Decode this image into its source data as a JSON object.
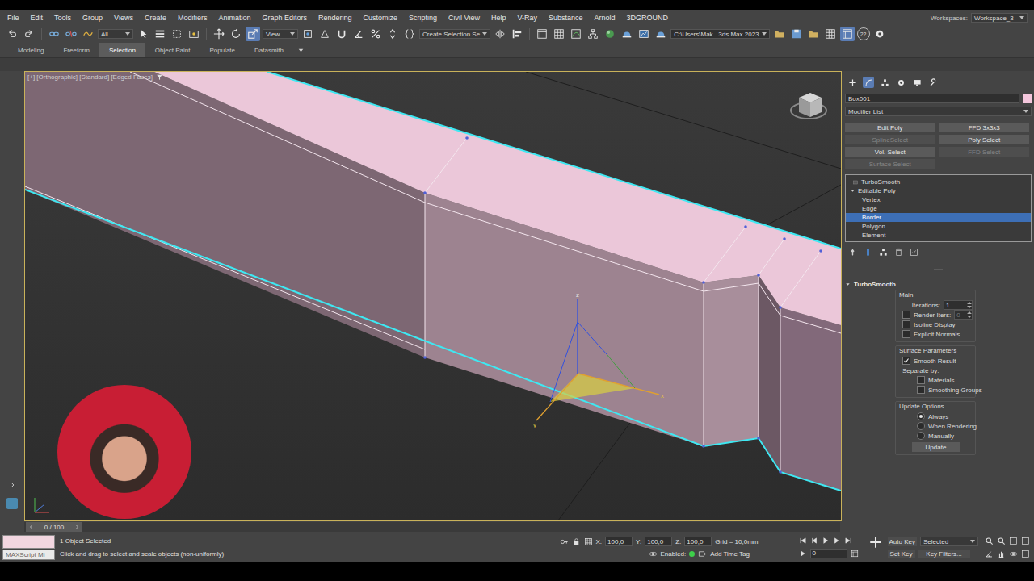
{
  "menu": [
    "File",
    "Edit",
    "Tools",
    "Group",
    "Views",
    "Create",
    "Modifiers",
    "Animation",
    "Graph Editors",
    "Rendering",
    "Customize",
    "Scripting",
    "Civil View",
    "Help",
    "V-Ray",
    "Substance",
    "Arnold",
    "3DGROUND"
  ],
  "workspace": {
    "label": "Workspaces:",
    "value": "Workspace_3"
  },
  "toolbar": {
    "selectionFilter": "All",
    "referenceCoordinates": "View",
    "namedSelection": "Create Selection Se",
    "projectPath": "C:\\Users\\Mak...3ds Max 2023",
    "badge": "22"
  },
  "ribbon": [
    {
      "label": "Modeling",
      "selected": false
    },
    {
      "label": "Freeform",
      "selected": false
    },
    {
      "label": "Selection",
      "selected": true
    },
    {
      "label": "Object Paint",
      "selected": false
    },
    {
      "label": "Populate",
      "selected": false
    },
    {
      "label": "Datasmith",
      "selected": false
    }
  ],
  "viewport": {
    "label": "[+] [Orthographic] [Standard] [Edged Faces]",
    "gizmoAxes": [
      "z",
      "x",
      "y"
    ]
  },
  "commandPanel": {
    "objectName": "Box001",
    "objectColor": "#f4c6dc",
    "modifierList": "Modifier List",
    "modifierButtons": [
      {
        "label": "Edit Poly",
        "disabled": false
      },
      {
        "label": "FFD 3x3x3",
        "disabled": false
      },
      {
        "label": "SplineSelect",
        "disabled": true
      },
      {
        "label": "Poly Select",
        "disabled": false
      },
      {
        "label": "Vol. Select",
        "disabled": false
      },
      {
        "label": "FFD Select",
        "disabled": true
      },
      {
        "label": "Surface Select",
        "disabled": true
      }
    ],
    "stack": [
      {
        "label": "TurboSmooth",
        "kind": "modifier",
        "selected": false
      },
      {
        "label": "Editable Poly",
        "kind": "object",
        "selected": false,
        "expanded": true
      },
      {
        "label": "Vertex",
        "kind": "subobject",
        "selected": false
      },
      {
        "label": "Edge",
        "kind": "subobject",
        "selected": false
      },
      {
        "label": "Border",
        "kind": "subobject",
        "selected": true
      },
      {
        "label": "Polygon",
        "kind": "subobject",
        "selected": false
      },
      {
        "label": "Element",
        "kind": "subobject",
        "selected": false
      }
    ],
    "rollout": {
      "title": "TurboSmooth",
      "expanded": true,
      "groups": [
        {
          "title": "Main",
          "rows": [
            {
              "kind": "spinner",
              "label": "Iterations:",
              "value": "1",
              "disabled": false
            },
            {
              "kind": "checkspinner",
              "label": "Render Iters:",
              "value": "0",
              "checked": false,
              "disabled": true
            },
            {
              "kind": "checkbox",
              "label": "Isoline Display",
              "checked": false,
              "disabled": false
            },
            {
              "kind": "checkbox",
              "label": "Explicit Normals",
              "checked": false,
              "disabled": false
            }
          ]
        },
        {
          "title": "Surface Parameters",
          "rows": [
            {
              "kind": "checkbox",
              "label": "Smooth Result",
              "checked": true,
              "disabled": false
            },
            {
              "kind": "heading",
              "label": "Separate by:"
            },
            {
              "kind": "subcheckbox",
              "label": "Materials",
              "checked": false,
              "disabled": false
            },
            {
              "kind": "subcheckbox",
              "label": "Smoothing Groups",
              "checked": false,
              "disabled": false
            }
          ]
        },
        {
          "title": "Update Options",
          "rows": [
            {
              "kind": "radio",
              "label": "Always",
              "selected": true
            },
            {
              "kind": "radio",
              "label": "When Rendering",
              "selected": false
            },
            {
              "kind": "radio",
              "label": "Manually",
              "selected": false
            },
            {
              "kind": "button",
              "label": "Update",
              "disabled": false
            }
          ]
        }
      ]
    }
  },
  "timeline": {
    "position": "0 / 100",
    "level": 0
  },
  "status": {
    "maxscript": "MAXScript Mi",
    "selection": "1 Object Selected",
    "prompt": "Click and drag to select and scale objects (non-uniformly)",
    "coords": [
      {
        "axis": "X:",
        "value": "100,0"
      },
      {
        "axis": "Y:",
        "value": "100,0"
      },
      {
        "axis": "Z:",
        "value": "100,0"
      }
    ],
    "grid": "Grid = 10,0mm",
    "enabled": {
      "label": "Enabled:",
      "on": true
    },
    "timeTag": "Add Time Tag",
    "autoKey": "Auto Key",
    "keyMode": "Selected",
    "setKey": "Set Key",
    "keyFilters": "Key Filters...",
    "frame": "0"
  }
}
